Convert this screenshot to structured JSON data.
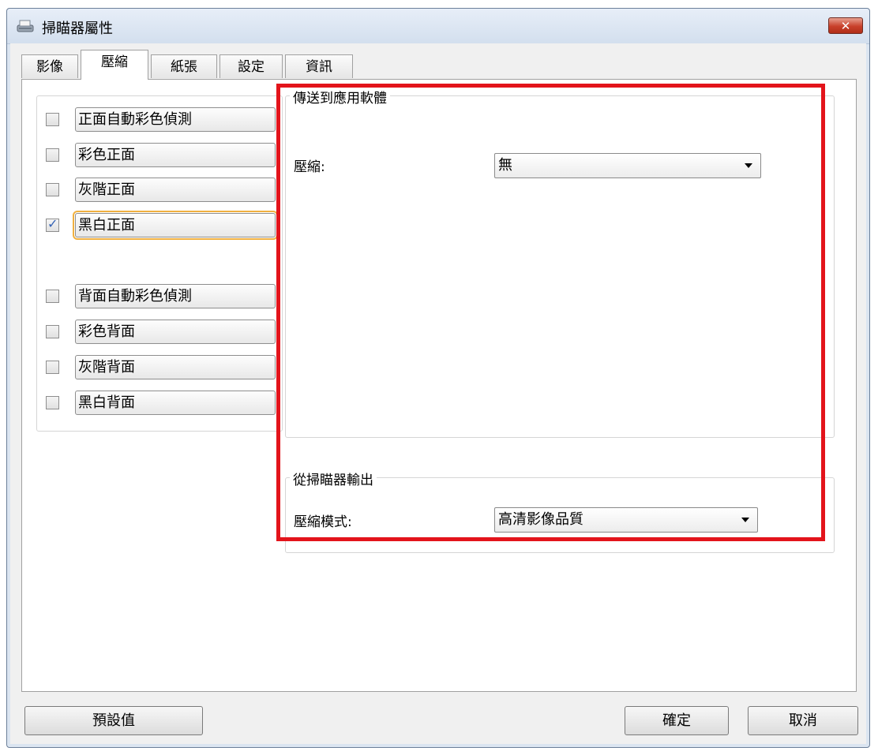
{
  "window": {
    "title": "掃瞄器屬性",
    "close_label": "✕",
    "icon": "scanner-icon"
  },
  "tabs": [
    {
      "label": "影像",
      "active": false
    },
    {
      "label": "壓縮",
      "active": true
    },
    {
      "label": "紙張",
      "active": false
    },
    {
      "label": "設定",
      "active": false
    },
    {
      "label": "資訊",
      "active": false
    }
  ],
  "image_options": {
    "front": [
      {
        "label": "正面自動彩色偵測",
        "checked": false
      },
      {
        "label": "彩色正面",
        "checked": false
      },
      {
        "label": "灰階正面",
        "checked": false
      },
      {
        "label": "黑白正面",
        "checked": true
      }
    ],
    "back": [
      {
        "label": "背面自動彩色偵測",
        "checked": false
      },
      {
        "label": "彩色背面",
        "checked": false
      },
      {
        "label": "灰階背面",
        "checked": false
      },
      {
        "label": "黑白背面",
        "checked": false
      }
    ]
  },
  "send_to_app": {
    "legend": "傳送到應用軟體",
    "compression_label": "壓縮:",
    "compression_value": "無"
  },
  "scanner_output": {
    "legend": "從掃瞄器輸出",
    "mode_label": "壓縮模式:",
    "mode_value": "高清影像品質"
  },
  "buttons": {
    "default": "預設值",
    "ok": "確定",
    "cancel": "取消"
  },
  "colors": {
    "highlight_border": "#e3141b",
    "focus_outline": "#f0b040",
    "check_color": "#3563b5"
  }
}
